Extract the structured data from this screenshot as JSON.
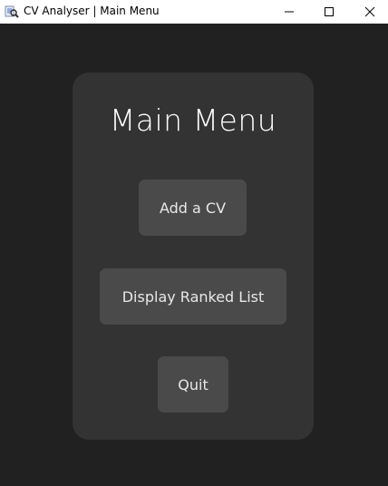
{
  "window": {
    "title": "CV Analyser | Main Menu",
    "controls": {
      "minimize": "minimize-icon",
      "maximize": "maximize-icon",
      "close": "close-icon"
    }
  },
  "menu": {
    "heading": "Main Menu",
    "buttons": {
      "add_cv": "Add a CV",
      "display_ranked": "Display Ranked List",
      "quit": "Quit"
    }
  },
  "colors": {
    "background": "#212121",
    "panel": "#333333",
    "button": "#4a4a4a",
    "text": "#ffffff"
  }
}
